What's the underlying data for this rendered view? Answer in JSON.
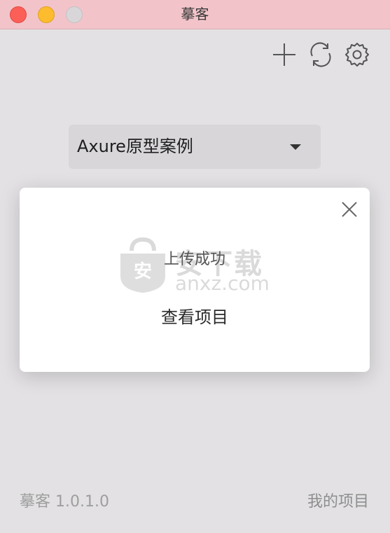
{
  "window": {
    "title": "摹客",
    "controls": [
      "close",
      "minimize",
      "maximize"
    ]
  },
  "toolbar": {
    "icons": [
      "add-icon",
      "refresh-icon",
      "settings-icon"
    ]
  },
  "project_select": {
    "value": "Axure原型案例"
  },
  "modal": {
    "message": "上传成功",
    "link": "查看项目",
    "watermark_cn": "安下载",
    "watermark_en": "anxz.com",
    "watermark_badge": "安"
  },
  "footer": {
    "version": "摹客 1.0.1.0",
    "my_projects": "我的项目"
  },
  "colors": {
    "titlebar": "#f2c4c9",
    "background": "#e3e1e4",
    "close": "#fc5f57",
    "minimize": "#fdbc2e",
    "maximize": "#d9d6d9"
  }
}
